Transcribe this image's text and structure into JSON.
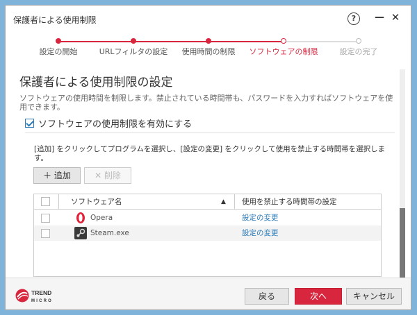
{
  "window": {
    "title": "保護者による使用制限",
    "help_symbol": "?",
    "minimize_symbol": "—",
    "close_symbol": "✕"
  },
  "colors": {
    "accent_red": "#d7263d",
    "link_blue": "#2b7bb9",
    "desktop_blue": "#7fb3d9"
  },
  "steps": [
    {
      "label": "設定の開始",
      "state": "done"
    },
    {
      "label": "URLフィルタの設定",
      "state": "done"
    },
    {
      "label": "使用時間の制限",
      "state": "done"
    },
    {
      "label": "ソフトウェアの制限",
      "state": "current"
    },
    {
      "label": "設定の完了",
      "state": "todo"
    }
  ],
  "main": {
    "heading": "保護者による使用制限の設定",
    "description": "ソフトウェアの使用時間を制限します。禁止されている時間帯も、パスワードを入力すればソフトウェアを使用できます。",
    "enable_label": "ソフトウェアの使用制限を有効にする",
    "enable_checked": true,
    "instruction": "[追加] をクリックしてプログラムを選択し、[設定の変更] をクリックして使用を禁止する時間帯を選択します。",
    "add_label": "＋ 追加",
    "delete_label": "✕ 削除"
  },
  "table": {
    "col_software": "ソフトウェア名",
    "sort_indicator": "▲",
    "col_schedule": "使用を禁止する時間帯の設定",
    "rows": [
      {
        "name": "Opera",
        "icon": "opera-icon",
        "action": "設定の変更"
      },
      {
        "name": "Steam.exe",
        "icon": "steam-icon",
        "action": "設定の変更"
      }
    ]
  },
  "footer": {
    "logo_line1": "TREND",
    "logo_line2": "MICRO",
    "back_label": "戻る",
    "next_label": "次へ",
    "cancel_label": "キャンセル"
  }
}
